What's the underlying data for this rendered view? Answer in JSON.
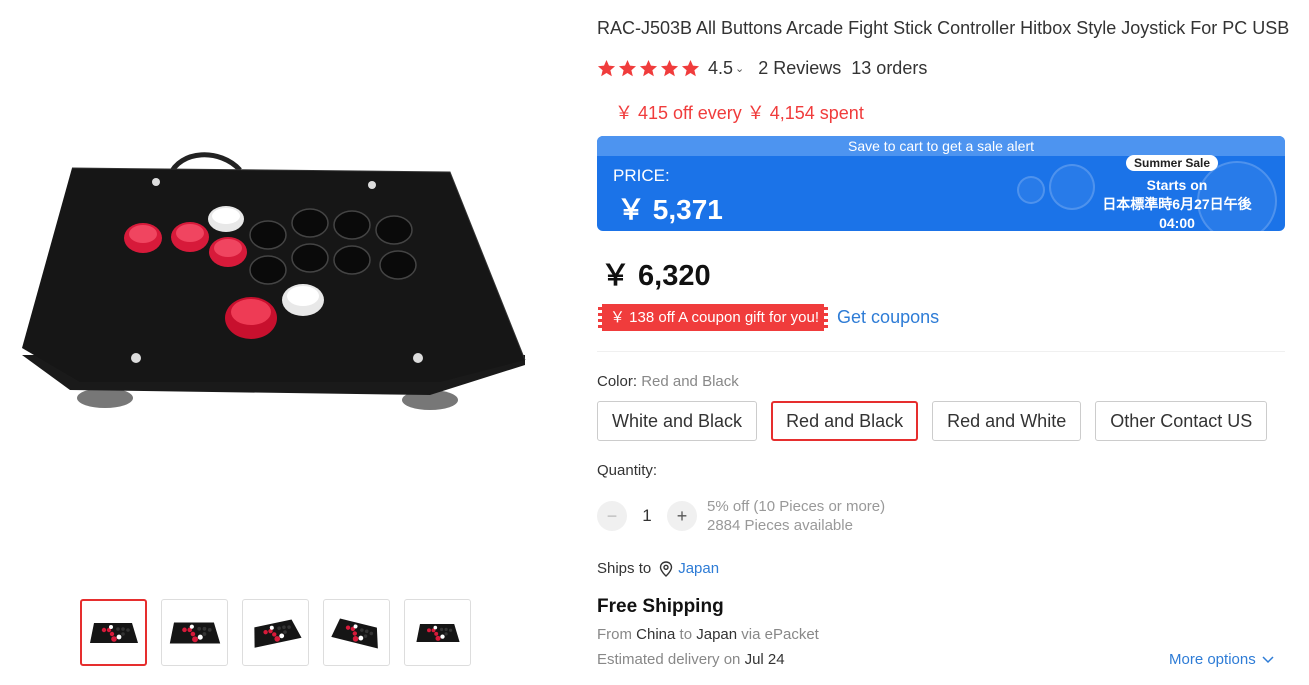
{
  "product": {
    "title": "RAC-J503B All Buttons Arcade Fight Stick Controller Hitbox Style Joystick For PC USB",
    "rating": "4.5",
    "reviews": "2 Reviews",
    "orders": "13 orders",
    "star_count": 5,
    "star_color": "#f03c3c"
  },
  "store_promo": "￥ 415 off every ￥ 4,154 spent",
  "price_banner": {
    "alert": "Save to cart to get a sale alert",
    "label": "PRICE:",
    "sale_price": "￥ 5,371",
    "badge": "Summer Sale",
    "starts_line1": "Starts on",
    "starts_line2": "日本標準時6月27日午後",
    "starts_line3": "04:00",
    "color": "#1b73e8"
  },
  "original_price": "￥ 6,320",
  "coupon": {
    "tag": "￥ 138 off A coupon gift for you!",
    "link": "Get coupons"
  },
  "color": {
    "label": "Color:",
    "selected": "Red and Black",
    "options": [
      "White and Black",
      "Red and Black",
      "Red and White",
      "Other Contact US"
    ]
  },
  "quantity": {
    "label": "Quantity:",
    "value": "1",
    "minus": "−",
    "plus": "+",
    "discount": "5% off (10 Pieces or more)",
    "available": "2884 Pieces available"
  },
  "shipping": {
    "ships_to_label": "Ships to",
    "country": "Japan",
    "pin_icon": "location-pin-icon",
    "free_shipping": "Free Shipping",
    "from_label": "From",
    "from": "China",
    "to_label": "to",
    "to": "Japan",
    "via": "via ePacket",
    "estimated_label": "Estimated delivery on",
    "estimated_date": "Jul 24",
    "more_options": "More options"
  },
  "gallery": {
    "thumb_count": 5,
    "active_index": 0
  }
}
